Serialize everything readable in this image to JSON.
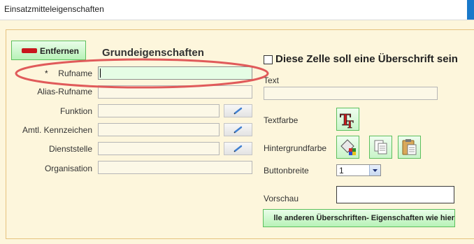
{
  "window": {
    "title": "Einsatzmitteleigenschaften"
  },
  "toolbar": {
    "remove_label": "Entfernen"
  },
  "basic": {
    "title": "Grundeigenschaften",
    "required_marker": "*",
    "fields": [
      {
        "label": "Rufname",
        "value": ""
      },
      {
        "label": "Alias-Rufname",
        "value": ""
      },
      {
        "label": "Funktion",
        "value": ""
      },
      {
        "label": "Amtl. Kennzeichen",
        "value": ""
      },
      {
        "label": "Dienststelle",
        "value": ""
      },
      {
        "label": "Organisation",
        "value": ""
      }
    ]
  },
  "header": {
    "checkbox_label": "Diese Zelle soll eine Überschrift sein",
    "checked": false,
    "text_label": "Text",
    "text_value": "",
    "textcolor_label": "Textfarbe",
    "bgcolor_label": "Hintergrundfarbe",
    "buttonwidth_label": "Buttonbreite",
    "buttonwidth_value": "1",
    "preview_label": "Vorschau",
    "apply_label": "lle anderen Überschriften- Eigenschaften wie hier"
  },
  "icons": {
    "remove": "minus-bar-icon",
    "edit": "pencil-icon",
    "textcolor": "text-color-icon",
    "fill": "paint-bucket-icon",
    "copy": "copy-icon",
    "paste": "paste-icon",
    "dropdown": "chevron-down-icon"
  },
  "colors": {
    "accent_green": "#b7f2b7",
    "active_field": "#e5fde5",
    "highlight": "#e05a5a",
    "title_bar_accent": "#1979ca"
  }
}
